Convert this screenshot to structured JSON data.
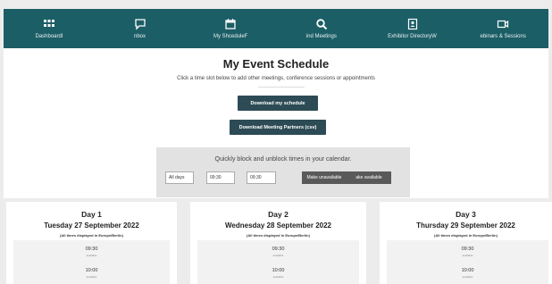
{
  "nav": {
    "items": [
      {
        "label": "Dashboardl",
        "icon": "grid-icon"
      },
      {
        "label": "nbox",
        "icon": "chat-icon"
      },
      {
        "label": "My ShceduleF",
        "icon": "calendar-icon"
      },
      {
        "label": "ind Meetings",
        "icon": "search-icon"
      },
      {
        "label": "Exhibitor DirectoryW",
        "icon": "badge-icon"
      },
      {
        "label": "ebinars & Sessions",
        "icon": "video-icon"
      }
    ]
  },
  "schedule": {
    "title": "My Event Schedule",
    "subtitle": "Click a time slot below to add other meetings, conference sessions or appointments",
    "download_schedule": "Download my schedule",
    "download_partners": "Download Meeting Partners (csv)"
  },
  "quick_block": {
    "title": "Quickly block and unblock times in your calendar.",
    "day_select": "All days",
    "from_time": "09:30",
    "to_time": "09:30",
    "make_unavailable": "Make unavailable",
    "make_available": "ake available"
  },
  "days": [
    {
      "title": "Day 1",
      "date": "Tuesday 27 September 2022",
      "timezone": "(All times displayed in Europe/Berlin)",
      "slots": [
        {
          "time": "09:30",
          "status": "available"
        },
        {
          "time": "10:00",
          "status": "available"
        }
      ]
    },
    {
      "title": "Day 2",
      "date": "Wednesday 28 September 2022",
      "timezone": "(All times displayed in Europe/Berlin)",
      "slots": [
        {
          "time": "09:30",
          "status": "available"
        },
        {
          "time": "10:00",
          "status": "available"
        }
      ]
    },
    {
      "title": "Day 3",
      "date": "Thursday 29 September 2022",
      "timezone": "(All times displayed in Europe/Berlin)",
      "slots": [
        {
          "time": "09:30",
          "status": "available"
        },
        {
          "time": "10:00",
          "status": "available"
        }
      ]
    }
  ],
  "colors": {
    "nav_bg": "#1c5e66",
    "button_dark": "#2d4b55",
    "button_gray": "#595959",
    "page_bg": "#ececec"
  }
}
